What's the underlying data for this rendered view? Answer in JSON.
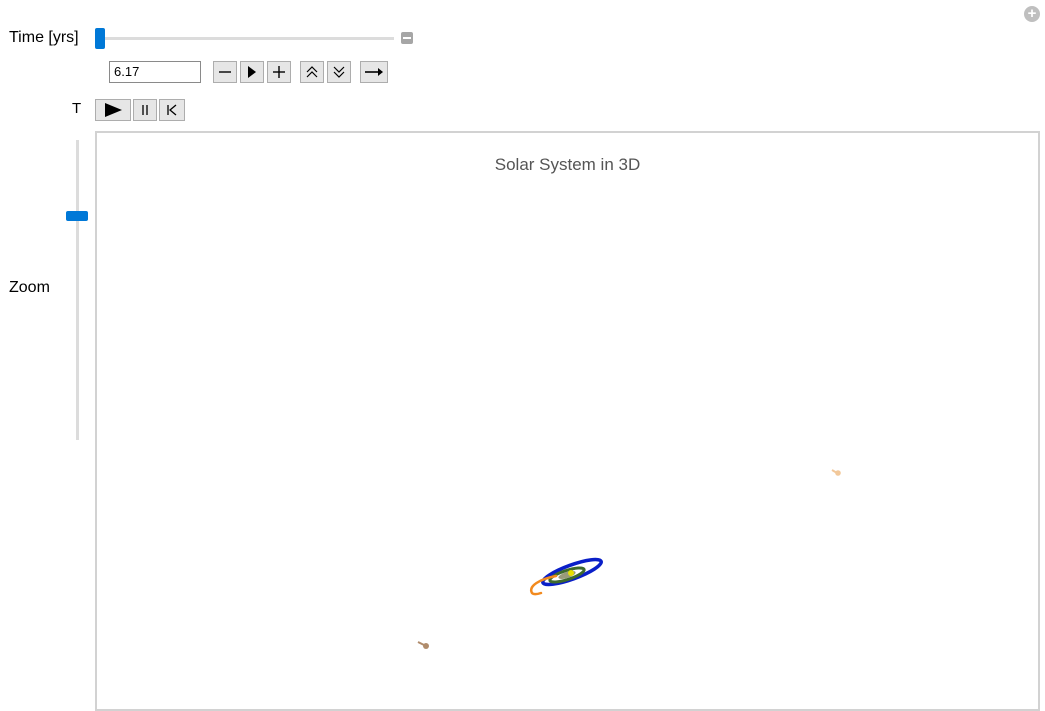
{
  "controls": {
    "time_label": "Time [yrs]",
    "time_value": "6.17",
    "t_label": "T",
    "zoom_label": "Zoom"
  },
  "plot": {
    "title": "Solar System in 3D"
  },
  "colors": {
    "accent": "#0078d7",
    "orbit_blue": "#0a1fc8",
    "orbit_green": "#3f6a2c",
    "orbit_orange": "#f28a1e",
    "sun": "#e8e000",
    "body_tan": "#b08c6c",
    "body_peach": "#f2c89a"
  },
  "icons": [
    "plus-circle-icon",
    "minus-square-icon",
    "minus-icon",
    "play-icon",
    "plus-icon",
    "chevrons-up-icon",
    "chevrons-down-icon",
    "arrow-right-icon",
    "pause-icon",
    "rewind-icon"
  ]
}
